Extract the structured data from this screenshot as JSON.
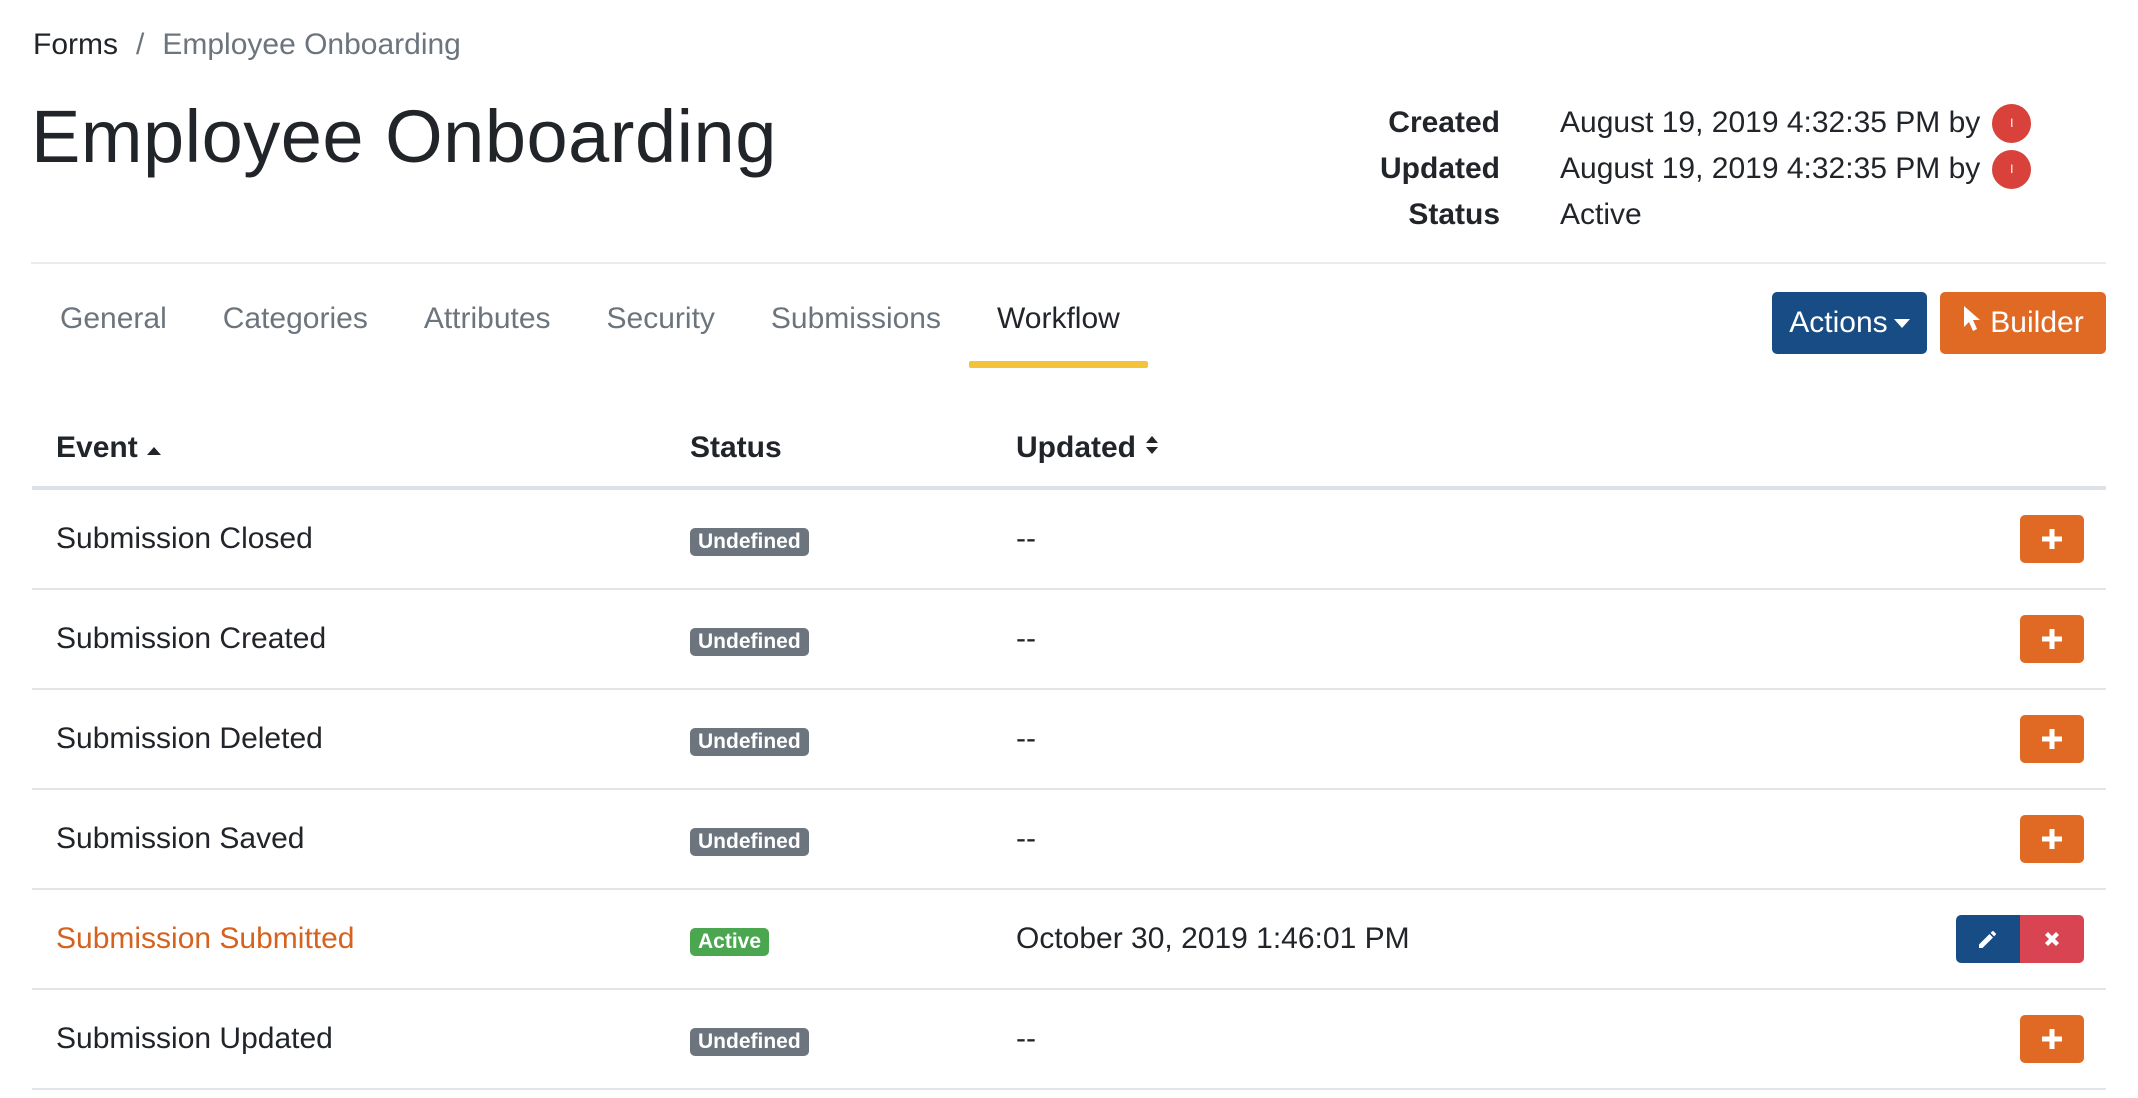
{
  "breadcrumb": {
    "root": "Forms",
    "separator": "/",
    "current": "Employee Onboarding"
  },
  "page": {
    "title": "Employee Onboarding"
  },
  "meta": {
    "created_label": "Created",
    "created_value": "August 19, 2019 4:32:35 PM by",
    "updated_label": "Updated",
    "updated_value": "August 19, 2019 4:32:35 PM by",
    "status_label": "Status",
    "status_value": "Active",
    "avatar_initial": "I"
  },
  "tabs": [
    {
      "label": "General",
      "active": false
    },
    {
      "label": "Categories",
      "active": false
    },
    {
      "label": "Attributes",
      "active": false
    },
    {
      "label": "Security",
      "active": false
    },
    {
      "label": "Submissions",
      "active": false
    },
    {
      "label": "Workflow",
      "active": true
    }
  ],
  "toolbar": {
    "actions_label": "Actions",
    "builder_label": "Builder"
  },
  "table": {
    "columns": {
      "event": "Event",
      "status": "Status",
      "updated": "Updated"
    },
    "rows": [
      {
        "event": "Submission Closed",
        "status": "Undefined",
        "updated": "--"
      },
      {
        "event": "Submission Created",
        "status": "Undefined",
        "updated": "--"
      },
      {
        "event": "Submission Deleted",
        "status": "Undefined",
        "updated": "--"
      },
      {
        "event": "Submission Saved",
        "status": "Undefined",
        "updated": "--"
      },
      {
        "event": "Submission Submitted",
        "status": "Active",
        "updated": "October 30, 2019 1:46:01 PM"
      },
      {
        "event": "Submission Updated",
        "status": "Undefined",
        "updated": "--"
      }
    ]
  },
  "colors": {
    "primary": "#174c85",
    "accent": "#e06a23",
    "danger": "#d94452",
    "tab_indicator": "#f3c43a",
    "badge_undefined": "#6c757d",
    "badge_active": "#4aa74f"
  },
  "icons": {
    "add": "plus-icon",
    "edit": "pencil-icon",
    "delete": "x-icon",
    "builder": "cursor-pointer-icon",
    "sort_asc": "sort-up-icon",
    "sort_both": "sort-both-icon",
    "dropdown": "caret-down-icon"
  }
}
